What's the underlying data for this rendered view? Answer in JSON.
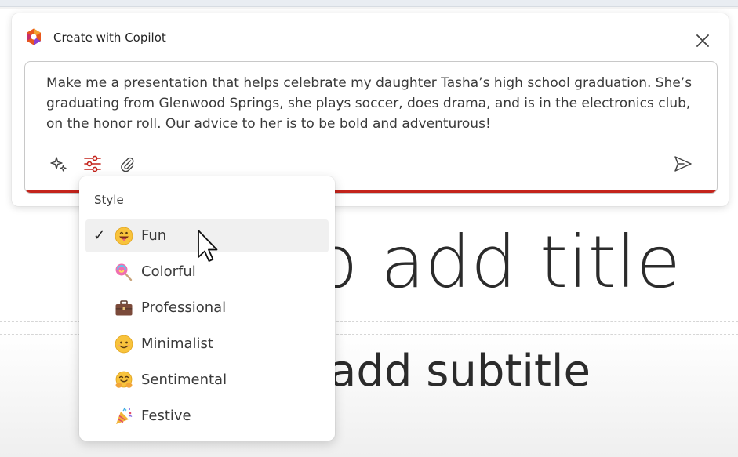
{
  "copilot_panel": {
    "title": "Create with Copilot",
    "prompt_text": "Make me a presentation that helps celebrate my daughter Tasha’s high school graduation. She’s graduating from Glenwood Springs, she plays soccer, does drama, and is in the electronics club, on the honor roll. Our advice to her is to be bold and adventurous!",
    "accent_color": "#c4241c",
    "toolbar_icons": [
      "sparkle-icon",
      "sliders-icon",
      "paperclip-icon"
    ],
    "send_icon": "send-icon",
    "close_icon": "close-icon"
  },
  "style_menu": {
    "header": "Style",
    "selected_index": 0,
    "items": [
      {
        "label": "Fun",
        "icon": "grinning-tongue-emoji",
        "selected": true
      },
      {
        "label": "Colorful",
        "icon": "lollipop-emoji",
        "selected": false
      },
      {
        "label": "Professional",
        "icon": "briefcase-emoji",
        "selected": false
      },
      {
        "label": "Minimalist",
        "icon": "smiling-face-emoji",
        "selected": false
      },
      {
        "label": "Sentimental",
        "icon": "hugging-face-emoji",
        "selected": false
      },
      {
        "label": "Festive",
        "icon": "party-popper-emoji",
        "selected": false
      }
    ]
  },
  "slide": {
    "title_placeholder": "o add title",
    "subtitle_placeholder": "add subtitle"
  }
}
